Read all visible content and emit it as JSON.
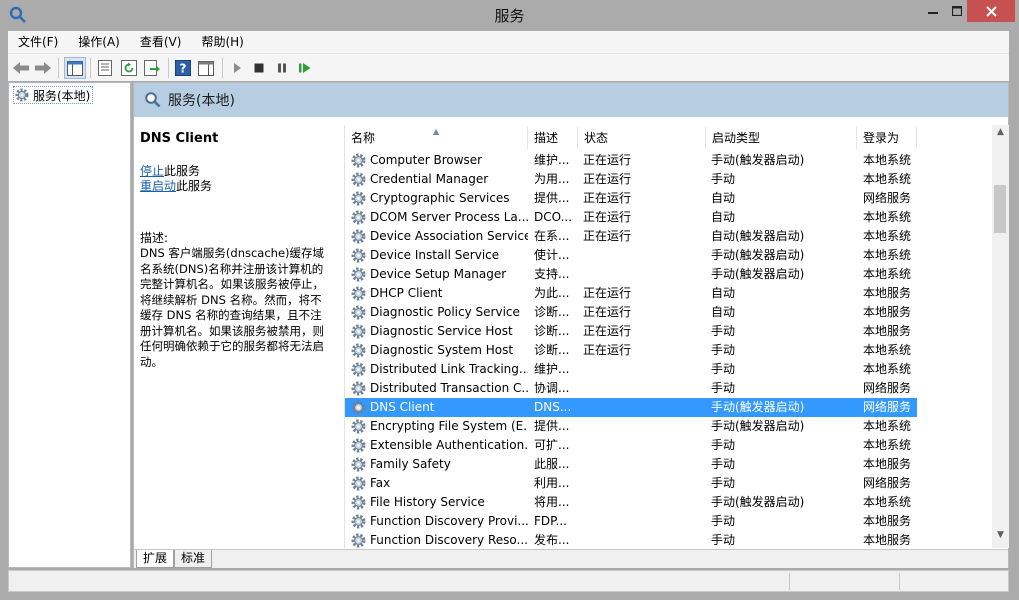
{
  "window": {
    "title": "服务",
    "colors": {
      "chrome": "#ababab",
      "close": "#c75050",
      "header": "#b7cde2",
      "selection": "#3399ff"
    }
  },
  "menu": [
    "文件(F)",
    "操作(A)",
    "查看(V)",
    "帮助(H)"
  ],
  "toolbar": {
    "icons": [
      "back-icon",
      "forward-icon",
      "show-console-tree-icon",
      "properties-icon",
      "refresh-icon",
      "export-list-icon",
      "help-icon",
      "show-action-pane-icon",
      "start-service-icon",
      "stop-service-icon",
      "pause-service-icon",
      "restart-service-icon"
    ]
  },
  "tree": {
    "root": "服务(本地)"
  },
  "header": {
    "title": "服务(本地)"
  },
  "description": {
    "service_name": "DNS Client",
    "stop_link": "停止",
    "stop_suffix": "此服务",
    "restart_link": "重启动",
    "restart_suffix": "此服务",
    "label": "描述:",
    "text": "DNS 客户端服务(dnscache)缓存域名系统(DNS)名称并注册该计算机的完整计算机名。如果该服务被停止，将继续解析 DNS 名称。然而，将不缓存 DNS 名称的查询结果，且不注册计算机名。如果该服务被禁用，则任何明确依赖于它的服务都将无法启动。"
  },
  "columns": [
    "名称",
    "描述",
    "状态",
    "启动类型",
    "登录为"
  ],
  "rows": [
    {
      "name": "Computer Browser",
      "desc": "维护...",
      "status": "正在运行",
      "start": "手动(触发器启动)",
      "logon": "本地系统"
    },
    {
      "name": "Credential Manager",
      "desc": "为用...",
      "status": "正在运行",
      "start": "手动",
      "logon": "本地系统"
    },
    {
      "name": "Cryptographic Services",
      "desc": "提供...",
      "status": "正在运行",
      "start": "自动",
      "logon": "网络服务"
    },
    {
      "name": "DCOM Server Process La...",
      "desc": "DCO...",
      "status": "正在运行",
      "start": "自动",
      "logon": "本地系统"
    },
    {
      "name": "Device Association Service",
      "desc": "在系...",
      "status": "正在运行",
      "start": "自动(触发器启动)",
      "logon": "本地系统"
    },
    {
      "name": "Device Install Service",
      "desc": "使计...",
      "status": "",
      "start": "手动(触发器启动)",
      "logon": "本地系统"
    },
    {
      "name": "Device Setup Manager",
      "desc": "支持...",
      "status": "",
      "start": "手动(触发器启动)",
      "logon": "本地系统"
    },
    {
      "name": "DHCP Client",
      "desc": "为此...",
      "status": "正在运行",
      "start": "自动",
      "logon": "本地服务"
    },
    {
      "name": "Diagnostic Policy Service",
      "desc": "诊断...",
      "status": "正在运行",
      "start": "自动",
      "logon": "本地服务"
    },
    {
      "name": "Diagnostic Service Host",
      "desc": "诊断...",
      "status": "正在运行",
      "start": "手动",
      "logon": "本地服务"
    },
    {
      "name": "Diagnostic System Host",
      "desc": "诊断...",
      "status": "正在运行",
      "start": "手动",
      "logon": "本地系统"
    },
    {
      "name": "Distributed Link Tracking...",
      "desc": "维护...",
      "status": "",
      "start": "手动",
      "logon": "本地系统"
    },
    {
      "name": "Distributed Transaction C...",
      "desc": "协调...",
      "status": "",
      "start": "手动",
      "logon": "网络服务"
    },
    {
      "name": "DNS Client",
      "desc": "DNS...",
      "status": "",
      "start": "手动(触发器启动)",
      "logon": "网络服务",
      "selected": true
    },
    {
      "name": "Encrypting File System (E...",
      "desc": "提供...",
      "status": "",
      "start": "手动(触发器启动)",
      "logon": "本地系统"
    },
    {
      "name": "Extensible Authentication...",
      "desc": "可扩...",
      "status": "",
      "start": "手动",
      "logon": "本地系统"
    },
    {
      "name": "Family Safety",
      "desc": "此服...",
      "status": "",
      "start": "手动",
      "logon": "本地服务"
    },
    {
      "name": "Fax",
      "desc": "利用...",
      "status": "",
      "start": "手动",
      "logon": "网络服务"
    },
    {
      "name": "File History Service",
      "desc": "将用...",
      "status": "",
      "start": "手动(触发器启动)",
      "logon": "本地系统"
    },
    {
      "name": "Function Discovery Provi...",
      "desc": "FDP...",
      "status": "",
      "start": "手动",
      "logon": "本地服务"
    },
    {
      "name": "Function Discovery Reso...",
      "desc": "发布...",
      "status": "",
      "start": "手动",
      "logon": "本地服务"
    }
  ],
  "tabs": [
    "扩展",
    "标准"
  ]
}
